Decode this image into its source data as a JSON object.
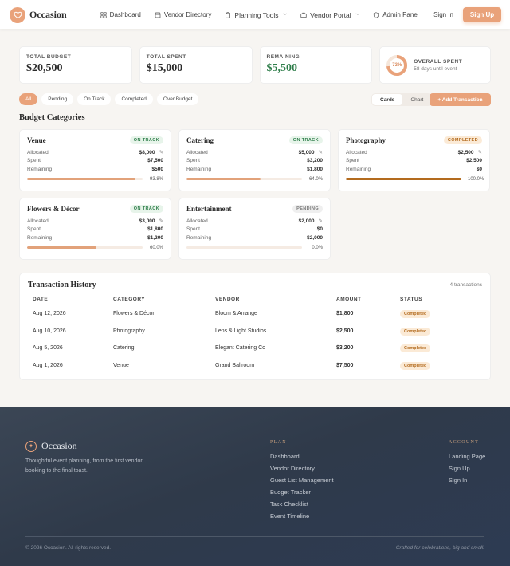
{
  "header": {
    "brand": "Occasion",
    "nav": [
      {
        "label": "Dashboard",
        "icon": "grid-icon"
      },
      {
        "label": "Vendor Directory",
        "icon": "store-icon"
      },
      {
        "label": "Planning Tools",
        "icon": "clipboard-icon",
        "dropdown": true
      },
      {
        "label": "Vendor Portal",
        "icon": "briefcase-icon",
        "dropdown": true
      },
      {
        "label": "Admin Panel",
        "icon": "shield-icon"
      }
    ],
    "sign_in": "Sign In",
    "sign_up": "Sign Up"
  },
  "stats": {
    "total_budget": {
      "label": "TOTAL BUDGET",
      "value": "$20,500"
    },
    "total_spent": {
      "label": "TOTAL SPENT",
      "value": "$15,000"
    },
    "remaining": {
      "label": "REMAINING",
      "value": "$5,500"
    },
    "overall": {
      "label": "OVERALL SPENT",
      "percent_text": "73%",
      "percent": 73,
      "sub": "58 days until event"
    }
  },
  "filters": [
    "All",
    "Pending",
    "On Track",
    "Completed",
    "Over Budget"
  ],
  "view_toggle": {
    "cards": "Cards",
    "chart": "Chart"
  },
  "add_transaction": "+ Add Transaction",
  "categories_title": "Budget Categories",
  "row_labels": {
    "allocated": "Allocated",
    "spent": "Spent",
    "remaining": "Remaining"
  },
  "categories": [
    {
      "name": "Venue",
      "status": "ON TRACK",
      "status_type": "track",
      "allocated": "$8,000",
      "spent": "$7,500",
      "remaining": "$500",
      "pct": "93.8%",
      "fill": 0.938
    },
    {
      "name": "Catering",
      "status": "ON TRACK",
      "status_type": "track",
      "allocated": "$5,000",
      "spent": "$3,200",
      "remaining": "$1,800",
      "pct": "64.0%",
      "fill": 0.64
    },
    {
      "name": "Photography",
      "status": "COMPLETED",
      "status_type": "done",
      "allocated": "$2,500",
      "spent": "$2,500",
      "remaining": "$0",
      "pct": "100.0%",
      "fill": 1.0
    },
    {
      "name": "Flowers & Décor",
      "status": "ON TRACK",
      "status_type": "track",
      "allocated": "$3,000",
      "spent": "$1,800",
      "remaining": "$1,200",
      "pct": "60.0%",
      "fill": 0.6
    },
    {
      "name": "Entertainment",
      "status": "PENDING",
      "status_type": "pend",
      "allocated": "$2,000",
      "spent": "$0",
      "remaining": "$2,000",
      "pct": "0.0%",
      "fill": 0.0
    }
  ],
  "transactions": {
    "title": "Transaction History",
    "count": "4 transactions",
    "headers": [
      "DATE",
      "CATEGORY",
      "VENDOR",
      "AMOUNT",
      "STATUS"
    ],
    "rows": [
      {
        "date": "Aug 12, 2026",
        "category": "Flowers & Décor",
        "vendor": "Bloom & Arrange",
        "amount": "$1,800",
        "status": "Completed"
      },
      {
        "date": "Aug 10, 2026",
        "category": "Photography",
        "vendor": "Lens & Light Studios",
        "amount": "$2,500",
        "status": "Completed"
      },
      {
        "date": "Aug 5, 2026",
        "category": "Catering",
        "vendor": "Elegant Catering Co",
        "amount": "$3,200",
        "status": "Completed"
      },
      {
        "date": "Aug 1, 2026",
        "category": "Venue",
        "vendor": "Grand Ballroom",
        "amount": "$7,500",
        "status": "Completed"
      }
    ]
  },
  "footer": {
    "brand": "Occasion",
    "description": "Thoughtful event planning, from the first vendor booking to the final toast.",
    "plan_heading": "PLAN",
    "plan_links": [
      "Dashboard",
      "Vendor Directory",
      "Guest List Management",
      "Budget Tracker",
      "Task Checklist",
      "Event Timeline"
    ],
    "account_heading": "ACCOUNT",
    "account_links": [
      "Landing Page",
      "Sign Up",
      "Sign In"
    ],
    "copyright": "© 2026 Occasion. All rights reserved.",
    "tagline": "Crafted for celebrations, big and small."
  },
  "colors": {
    "accent": "#e9a27a",
    "green": "#2e7d4a",
    "completed": "#b36b1e",
    "footer_bg": "#2f3a4a"
  }
}
